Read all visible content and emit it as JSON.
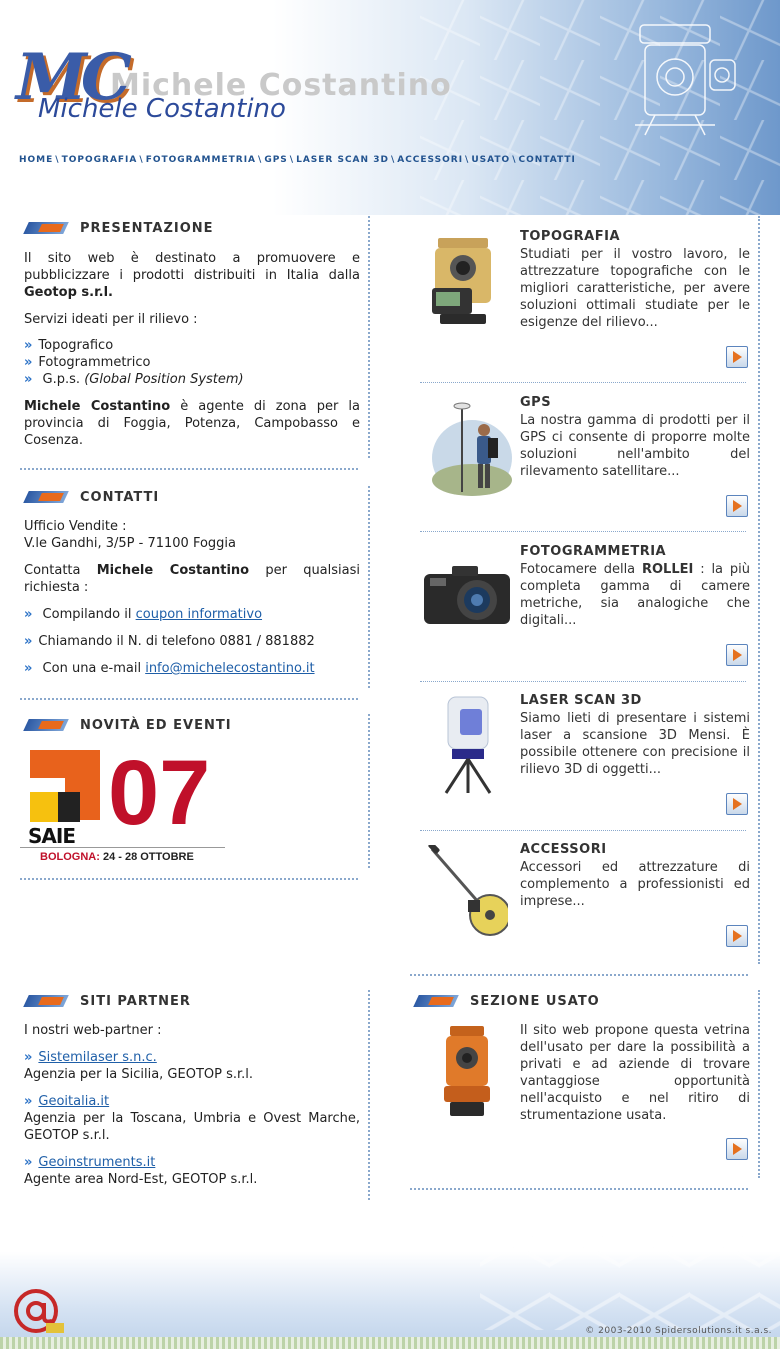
{
  "header": {
    "logo_mark": "MC",
    "logo_ghost": "Michele Costantino",
    "logo_name": "Michele Costantino"
  },
  "nav": [
    "HOME",
    "TOPOGRAFIA",
    "FOTOGRAMMETRIA",
    "GPS",
    "LASER SCAN 3D",
    "ACCESSORI",
    "USATO",
    "CONTATTI"
  ],
  "nav_separator": "\\",
  "presentazione": {
    "title": "PRESENTAZIONE",
    "intro_pre": "Il sito web è destinato a promuovere e pubblicizzare i prodotti distribuiti in Italia dalla ",
    "intro_bold": "Geotop s.r.l.",
    "services_label": "Servizi ideati per il rilievo :",
    "services": [
      "Topografico",
      "Fotogrammetrico"
    ],
    "gps_service": "G.p.s.",
    "gps_service_note": "(Global Position System)",
    "agent_name": "Michele Costantino",
    "agent_text": " è agente di zona per la provincia di Foggia, Potenza, Campobasso e Cosenza."
  },
  "contatti": {
    "title": "CONTATTI",
    "office_label": "Ufficio Vendite :",
    "office_address": "V.le Gandhi, 3/5P - 71100 Foggia",
    "contact_pre": "Contatta ",
    "contact_name": "Michele Costantino",
    "contact_post": " per qualsiasi richiesta :",
    "coupon_pre": "Compilando il ",
    "coupon_link": "coupon informativo",
    "phone_text": "Chiamando il N. di telefono 0881 / 881882",
    "email_pre": "Con una e-mail ",
    "email_link": "info@michelecostantino.it"
  },
  "novita": {
    "title": "NOVITÀ ED EVENTI",
    "banner_word": "SAIE",
    "banner_num": "07",
    "banner_city": "BOLOGNA:",
    "banner_dates": "24 - 28 OTTOBRE"
  },
  "products": [
    {
      "title": "TOPOGRAFIA",
      "text": "Studiati per il vostro lavoro, le attrezzature topografiche con le migliori caratteristiche, per avere soluzioni ottimali studiate per le esigenze del rilievo..."
    },
    {
      "title": "GPS",
      "text": "La nostra gamma di prodotti per il GPS ci consente di proporre molte soluzioni nell'ambito del rilevamento satellitare..."
    },
    {
      "title": "FOTOGRAMMETRIA",
      "text_pre": "Fotocamere della ",
      "text_bold": "ROLLEI",
      "text_post": " : la più completa gamma di camere metriche, sia analogiche che digitali..."
    },
    {
      "title": "LASER SCAN 3D",
      "text": "Siamo lieti di presentare i sistemi laser a scansione 3D Mensi. È possibile ottenere con precisione il rilievo 3D di oggetti..."
    },
    {
      "title": "ACCESSORI",
      "text": "Accessori ed attrezzature di complemento a professionisti ed imprese..."
    }
  ],
  "partner": {
    "title": "SITI PARTNER",
    "intro": "I nostri web-partner :",
    "items": [
      {
        "link": "Sistemilaser s.n.c.",
        "desc": "Agenzia per la Sicilia, GEOTOP s.r.l."
      },
      {
        "link": "Geoitalia.it",
        "desc": "Agenzia per la Toscana, Umbria e Ovest Marche, GEOTOP s.r.l."
      },
      {
        "link": "Geoinstruments.it",
        "desc": "Agente area Nord-Est, GEOTOP s.r.l."
      }
    ]
  },
  "usato": {
    "title": "SEZIONE USATO",
    "text": "Il sito web propone questa vetrina dell'usato per dare la possibilità a privati e ad aziende di trovare vantaggiose opportunità nell'acquisto e nel ritiro di strumentazione usata."
  },
  "footer": {
    "copyright": "© 2003-2010 Spidersolutions.it s.a.s."
  },
  "colors": {
    "accent_blue": "#22538f",
    "accent_orange": "#e86a1c",
    "saie_red": "#c0102a"
  }
}
